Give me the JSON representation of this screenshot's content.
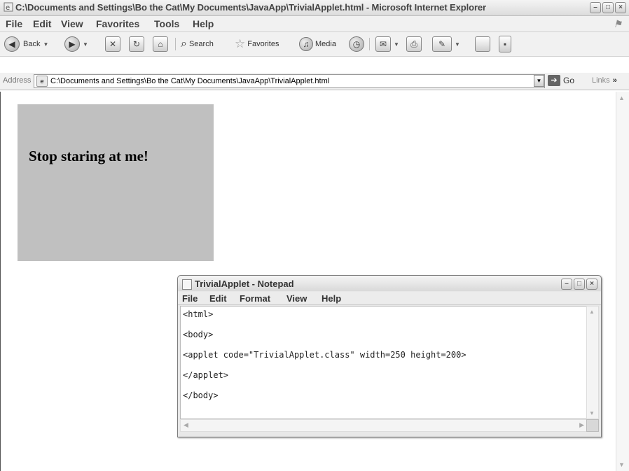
{
  "window": {
    "title": "C:\\Documents and Settings\\Bo the Cat\\My Documents\\JavaApp\\TrivialApplet.html - Microsoft Internet Explorer"
  },
  "menubar": {
    "items": [
      "File",
      "Edit",
      "View",
      "Favorites",
      "Tools",
      "Help"
    ]
  },
  "toolbar": {
    "back_label": "Back",
    "search_label": "Search",
    "favorites_label": "Favorites",
    "media_label": "Media"
  },
  "address": {
    "label": "Address",
    "value": "C:\\Documents and Settings\\Bo the Cat\\My Documents\\JavaApp\\TrivialApplet.html",
    "go_label": "Go",
    "links_label": "Links"
  },
  "applet": {
    "message": "Stop staring at me!"
  },
  "notepad": {
    "title": "TrivialApplet - Notepad",
    "menu": [
      "File",
      "Edit",
      "Format",
      "View",
      "Help"
    ],
    "lines": [
      "<html>",
      "<body>",
      "<applet code=\"TrivialApplet.class\" width=250 height=200>",
      "</applet>",
      "</body>"
    ]
  },
  "icons": [
    "ie-page-icon",
    "back-icon",
    "forward-icon",
    "stop-icon",
    "refresh-icon",
    "home-icon",
    "search-icon",
    "favorites-icon",
    "media-icon",
    "history-icon",
    "mail-icon",
    "print-icon",
    "edit-icon",
    "discuss-icon",
    "messenger-icon",
    "go-icon",
    "notepad-icon"
  ]
}
